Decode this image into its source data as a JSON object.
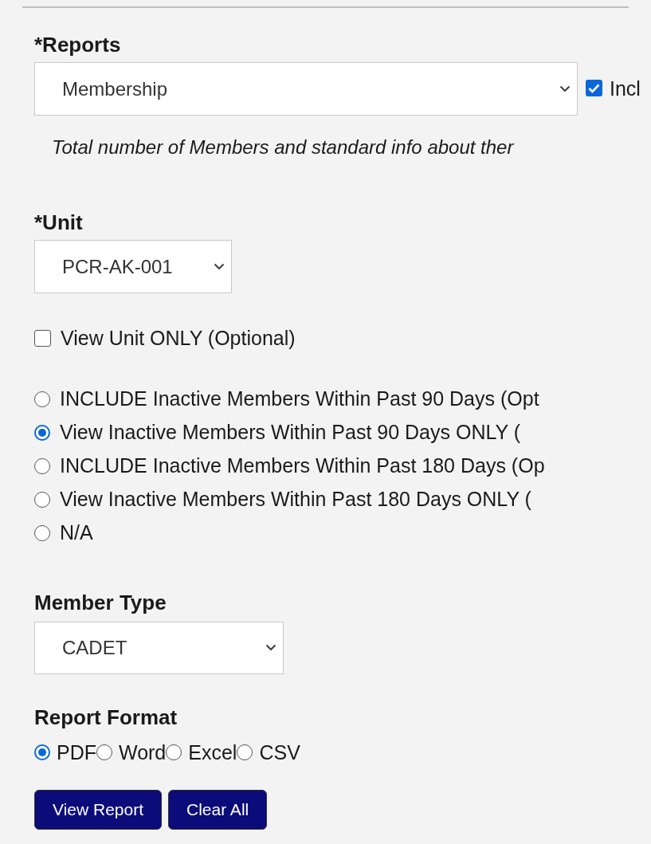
{
  "reports": {
    "label": "*Reports",
    "value": "Membership",
    "include_checkbox": {
      "label": "Incl",
      "checked": true
    },
    "description": "Total number of Members and standard info about ther"
  },
  "unit": {
    "label": "*Unit",
    "value": "PCR-AK-001",
    "unit_only": {
      "label": "View Unit ONLY (Optional)",
      "checked": false
    }
  },
  "inactive_options": [
    {
      "label": "INCLUDE Inactive Members Within Past 90 Days (Opt",
      "selected": false
    },
    {
      "label": "View Inactive Members Within Past 90 Days ONLY (",
      "selected": true
    },
    {
      "label": "INCLUDE Inactive Members Within Past 180 Days (Op",
      "selected": false
    },
    {
      "label": "View Inactive Members Within Past 180 Days ONLY (",
      "selected": false
    },
    {
      "label": "N/A",
      "selected": false
    }
  ],
  "member_type": {
    "label": "Member Type",
    "value": "CADET"
  },
  "report_format": {
    "label": "Report Format",
    "options": [
      {
        "label": "PDF",
        "selected": true
      },
      {
        "label": "Word",
        "selected": false
      },
      {
        "label": "Excel",
        "selected": false
      },
      {
        "label": "CSV",
        "selected": false
      }
    ]
  },
  "buttons": [
    "View Report",
    "Clear All"
  ]
}
